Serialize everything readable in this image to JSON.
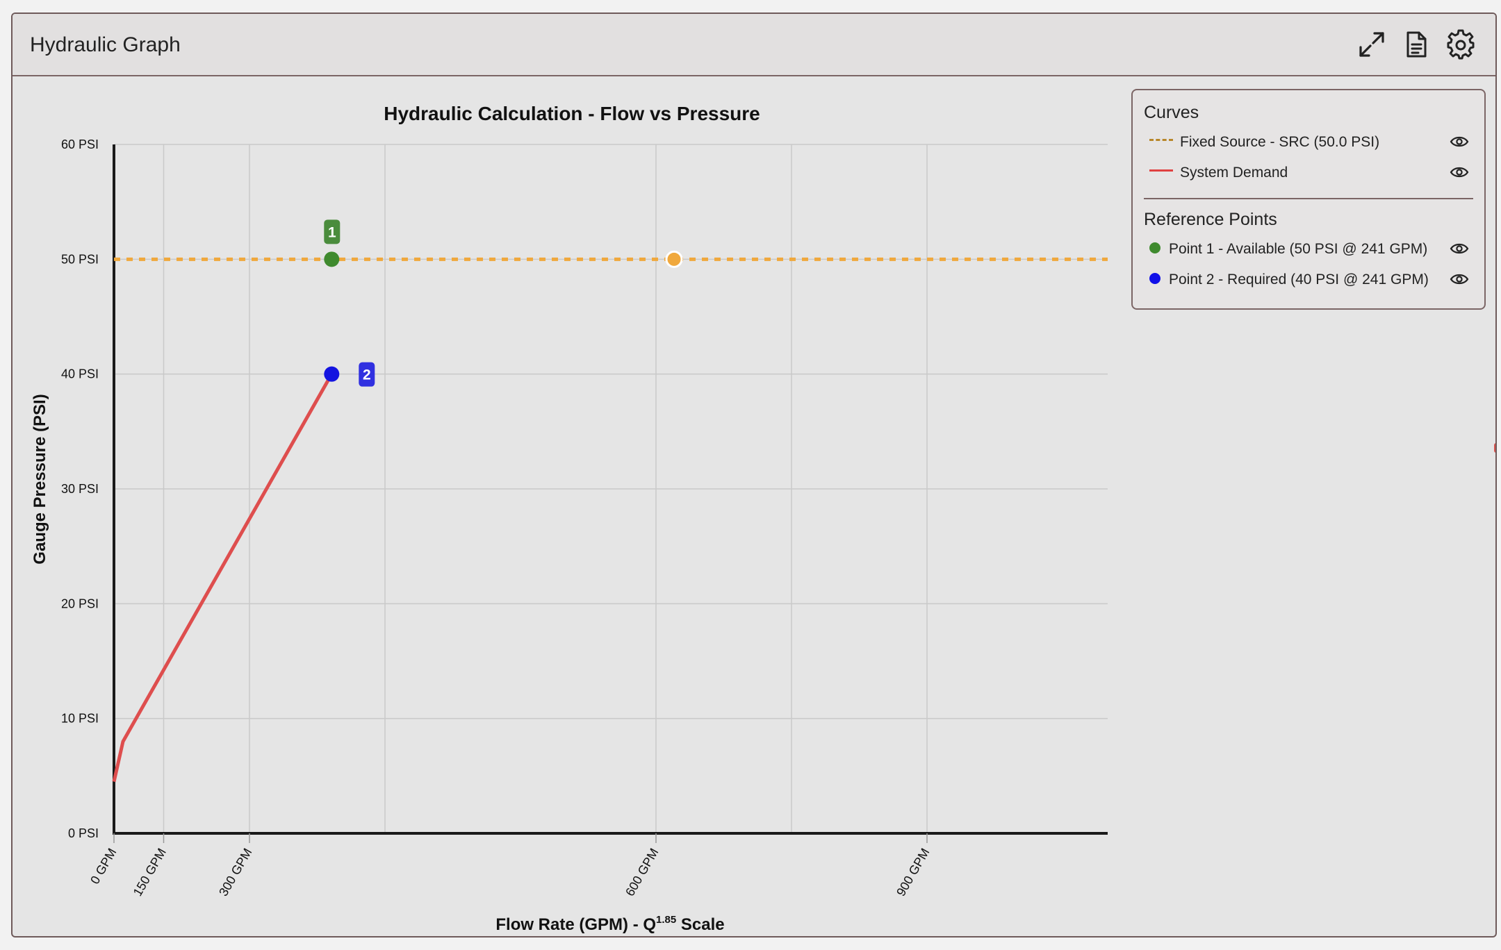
{
  "window": {
    "title": "Hydraulic Graph"
  },
  "toolbar": {
    "expand_icon": "expand-icon",
    "report_icon": "document-icon",
    "settings_icon": "gear-icon"
  },
  "chart_data": {
    "type": "line",
    "title": "Hydraulic Calculation - Flow vs Pressure",
    "xlabel_main": "Flow Rate (GPM) - Q",
    "xlabel_sup": "1.85",
    "xlabel_tail": " Scale",
    "ylabel": "Gauge Pressure (PSI)",
    "x_scale": "Q^1.85",
    "xlim": [
      0,
      1100
    ],
    "ylim": [
      0,
      60
    ],
    "grid": true,
    "x_grid_values": [
      0,
      55,
      150,
      300,
      600,
      750,
      900
    ],
    "x_ticks": [
      {
        "value": 0,
        "label": "0 GPM"
      },
      {
        "value": 55,
        "label": "150 GPM"
      },
      {
        "value": 150,
        "label": "300 GPM"
      },
      {
        "value": 600,
        "label": "600 GPM"
      },
      {
        "value": 900,
        "label": "900 GPM"
      }
    ],
    "y_ticks": [
      {
        "value": 0,
        "label": "0 PSI"
      },
      {
        "value": 10,
        "label": "10 PSI"
      },
      {
        "value": 20,
        "label": "20 PSI"
      },
      {
        "value": 30,
        "label": "30 PSI"
      },
      {
        "value": 40,
        "label": "40 PSI"
      },
      {
        "value": 50,
        "label": "50 PSI"
      },
      {
        "value": 60,
        "label": "60 PSI"
      }
    ],
    "series": [
      {
        "name": "Fixed Source - SRC (50.0 PSI)",
        "color": "#f0a83c",
        "style": "dashed",
        "points": [
          [
            0,
            50
          ],
          [
            1100,
            50
          ]
        ],
        "marker": [
          620,
          50
        ]
      },
      {
        "name": "System Demand",
        "color": "#de4e4e",
        "style": "solid",
        "points": [
          [
            0,
            4.5
          ],
          [
            10,
            8
          ],
          [
            241,
            40
          ]
        ]
      }
    ],
    "reference_points": [
      {
        "label": "1",
        "x": 241,
        "y": 50,
        "color": "#3f8a2e",
        "badge_color": "#4a8c3c"
      },
      {
        "label": "2",
        "x": 241,
        "y": 40,
        "color": "#1414e0",
        "badge_color": "#3030e0"
      }
    ]
  },
  "legend": {
    "curves_heading": "Curves",
    "curves": [
      {
        "label": "Fixed Source - SRC (50.0 PSI)",
        "color": "#b8862a",
        "style": "dashed",
        "icon": "eye-icon"
      },
      {
        "label": "System Demand",
        "color": "#e04040",
        "style": "solid",
        "icon": "eye-icon"
      }
    ],
    "points_heading": "Reference Points",
    "points": [
      {
        "label": "Point 1 - Available (50 PSI @ 241 GPM)",
        "color": "#3f8a2e",
        "icon": "eye-icon"
      },
      {
        "label": "Point 2 - Required (40 PSI @ 241 GPM)",
        "color": "#1010e8",
        "icon": "eye-icon"
      }
    ]
  }
}
